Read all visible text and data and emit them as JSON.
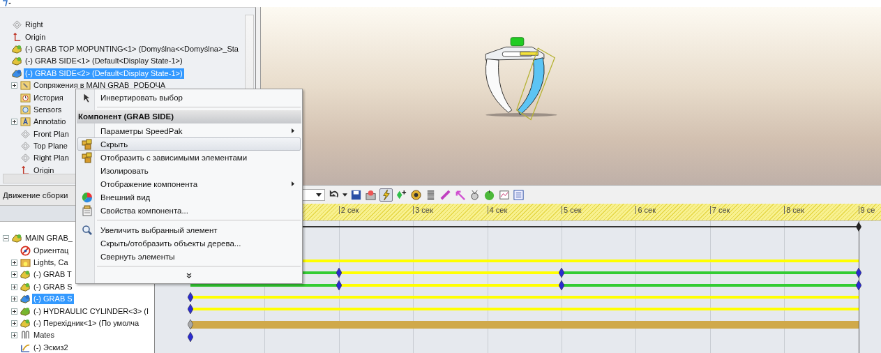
{
  "feature_tree": {
    "items": [
      {
        "label": "Right",
        "kind": "plane",
        "selected": false
      },
      {
        "label": "Origin",
        "kind": "origin",
        "selected": false
      },
      {
        "label": "(-) GRAB TOP MOPUNTING<1> (Domyślna<<Domyślna>_Sta",
        "kind": "part",
        "selected": false
      },
      {
        "label": "(-) GRAB SIDE<1> (Default<Display State-1>)",
        "kind": "part",
        "selected": false
      },
      {
        "label": "(-) GRAB SIDE<2> (Default<Display State-1>)",
        "kind": "part",
        "selected": true,
        "children": [
          {
            "label": "Сопряжения в MAIN GRAB_РОБОЧА",
            "kind": "mates",
            "selected": false,
            "expanded": false
          },
          {
            "label": "История",
            "kind": "history",
            "selected": false
          },
          {
            "label": "Sensors",
            "kind": "sensors",
            "selected": false
          },
          {
            "label": "Annotatio",
            "kind": "annotations",
            "selected": false,
            "expanded": false
          },
          {
            "label": "Front Plan",
            "kind": "plane",
            "selected": false
          },
          {
            "label": "Top Plane",
            "kind": "plane",
            "selected": false
          },
          {
            "label": "Right Plan",
            "kind": "plane",
            "selected": false
          },
          {
            "label": "Origin",
            "kind": "origin",
            "selected": false
          }
        ]
      }
    ]
  },
  "motion_study": {
    "tab": "Движение сборки",
    "tree": [
      {
        "label": "MAIN GRAB_",
        "kind": "part",
        "selected": false,
        "expanded": true,
        "children": [
          {
            "label": "Ориентац",
            "kind": "orientation",
            "selected": false
          },
          {
            "label": "Lights, Ca",
            "kind": "lights",
            "selected": false,
            "expanded": false
          },
          {
            "label": "(-) GRAB T",
            "kind": "part",
            "selected": false,
            "expanded": false
          },
          {
            "label": "(-) GRAB S",
            "kind": "part",
            "selected": false,
            "expanded": false
          },
          {
            "label": "(-) GRAB S",
            "kind": "part",
            "selected": true,
            "expanded": false
          },
          {
            "label": "(-) HYDRAULIC CYLINDER<3> (I",
            "kind": "assembly",
            "selected": false,
            "expanded": false
          },
          {
            "label": "(-) Перехідник<1> (По умолча",
            "kind": "part",
            "selected": false,
            "expanded": false
          },
          {
            "label": "Mates",
            "kind": "mates_group",
            "selected": false,
            "expanded": false
          },
          {
            "label": "(-) Эскиз2",
            "kind": "sketch",
            "selected": false
          }
        ]
      }
    ],
    "ruler": [
      {
        "label": "2 сек"
      },
      {
        "label": "3 сек"
      },
      {
        "label": "4 сек"
      },
      {
        "label": "5 сек"
      },
      {
        "label": "6 сек"
      },
      {
        "label": "7 сек"
      },
      {
        "label": "8 сек"
      },
      {
        "label": "9 се"
      }
    ]
  },
  "context_menu": {
    "items": [
      {
        "kind": "item",
        "label": "Инвертировать выбор",
        "selected": false,
        "submenu": false
      },
      {
        "kind": "separator"
      },
      {
        "kind": "header",
        "label": "Компонент (GRAB SIDE)"
      },
      {
        "kind": "item",
        "label": "Параметры SpeedPak",
        "selected": false,
        "submenu": true
      },
      {
        "kind": "item",
        "label": "Скрыть",
        "selected": true,
        "submenu": false
      },
      {
        "kind": "item",
        "label": "Отобразить с зависимыми элементами",
        "selected": false,
        "submenu": false
      },
      {
        "kind": "item",
        "label": "Изолировать",
        "selected": false,
        "submenu": false
      },
      {
        "kind": "item",
        "label": "Отображение компонента",
        "selected": false,
        "submenu": true
      },
      {
        "kind": "item",
        "label": "Внешний вид",
        "selected": false,
        "submenu": false
      },
      {
        "kind": "item",
        "label": "Свойства компонента...",
        "selected": false,
        "submenu": false
      },
      {
        "kind": "separator"
      },
      {
        "kind": "item",
        "label": "Увеличить выбранный элемент",
        "selected": false,
        "submenu": false
      },
      {
        "kind": "item",
        "label": "Скрыть/отобразить объекты дерева...",
        "selected": false,
        "submenu": false
      },
      {
        "kind": "item",
        "label": "Свернуть элементы",
        "selected": false,
        "submenu": false
      },
      {
        "kind": "separator"
      },
      {
        "kind": "more"
      }
    ]
  }
}
